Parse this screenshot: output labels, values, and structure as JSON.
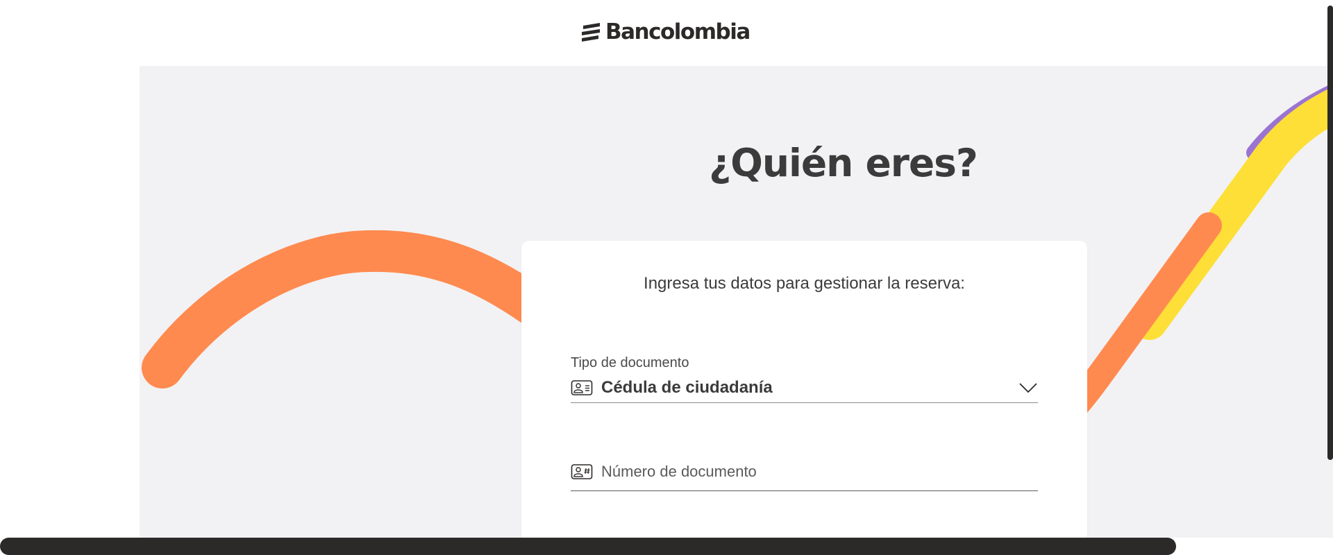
{
  "brand": {
    "name": "Bancolombia",
    "logo_icon": "bancolombia-stripes-icon"
  },
  "colors": {
    "orange": "#ff8a50",
    "yellow": "#fddf38",
    "purple": "#9b74d3",
    "background": "#f2f2f4",
    "text": "#2c2a29"
  },
  "hero": {
    "title": "¿Quién eres?"
  },
  "form": {
    "subtitle": "Ingresa tus datos para gestionar la reserva:",
    "doc_type": {
      "label": "Tipo de documento",
      "value": "Cédula de ciudadanía",
      "icon": "id-card-icon",
      "dropdown_icon": "chevron-down-icon"
    },
    "doc_number": {
      "placeholder": "Número de documento",
      "value": "",
      "icon": "id-number-icon"
    }
  }
}
